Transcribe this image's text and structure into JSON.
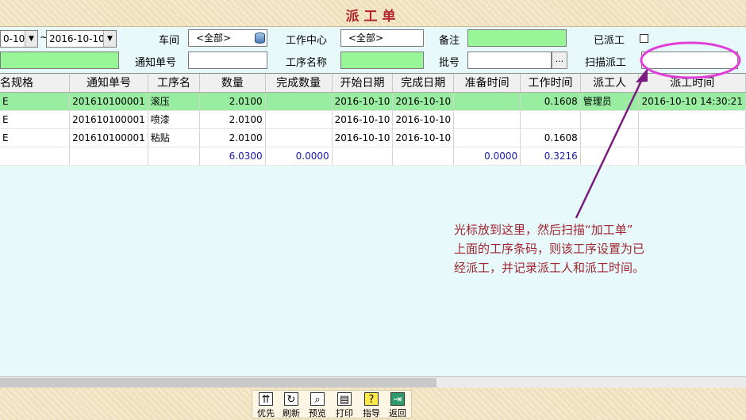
{
  "title": "派工单",
  "filters": {
    "date_from": "0-10",
    "date_to": "2016-10-10",
    "tilde": "~",
    "workshop_label": "车间",
    "workshop_value": "<全部>",
    "work_center_label": "工作中心",
    "work_center_value": "<全部>",
    "remark_label": "备注",
    "dispatched_label": "已派工",
    "notice_no_label": "通知单号",
    "process_name_label": "工序名称",
    "batch_label": "批号",
    "scan_label": "扫描派工",
    "ellipsis": "..."
  },
  "table": {
    "headers": [
      "名规格",
      "通知单号",
      "工序名",
      "数量",
      "完成数量",
      "开始日期",
      "完成日期",
      "准备时间",
      "工作时间",
      "派工人",
      "派工时间"
    ],
    "rows": [
      {
        "c0": "E",
        "c1": "201610100001",
        "c2": "滚压",
        "c3": "2.0100",
        "c4": "",
        "c5": "2016-10-10",
        "c6": "2016-10-10",
        "c7": "",
        "c8": "0.1608",
        "c9": "管理员",
        "c10": "2016-10-10 14:30:21"
      },
      {
        "c0": "E",
        "c1": "201610100001",
        "c2": "喷漆",
        "c3": "2.0100",
        "c4": "",
        "c5": "2016-10-10",
        "c6": "2016-10-10",
        "c7": "",
        "c8": "",
        "c9": "",
        "c10": ""
      },
      {
        "c0": "E",
        "c1": "201610100001",
        "c2": "粘贴",
        "c3": "2.0100",
        "c4": "",
        "c5": "2016-10-10",
        "c6": "2016-10-10",
        "c7": "",
        "c8": "0.1608",
        "c9": "",
        "c10": ""
      }
    ],
    "totals": {
      "c3": "6.0300",
      "c4": "0.0000",
      "c7": "0.0000",
      "c8": "0.3216"
    }
  },
  "annotation": {
    "line1": "光标放到这里，然后扫描“加工单”",
    "line2": "上面的工序条码，则该工序设置为已",
    "line3": "经派工，并记录派工人和派工时间。",
    "color": "#a0262f",
    "arrow_color": "#7b1c80",
    "circle_color": "#e040d8"
  },
  "toolbar": {
    "buttons": [
      {
        "label": "优先",
        "icon": "priority-icon"
      },
      {
        "label": "刷新",
        "icon": "refresh-icon"
      },
      {
        "label": "预览",
        "icon": "preview-icon"
      },
      {
        "label": "打印",
        "icon": "printer-icon"
      },
      {
        "label": "指导",
        "icon": "help-icon"
      },
      {
        "label": "返回",
        "icon": "exit-icon"
      }
    ]
  }
}
